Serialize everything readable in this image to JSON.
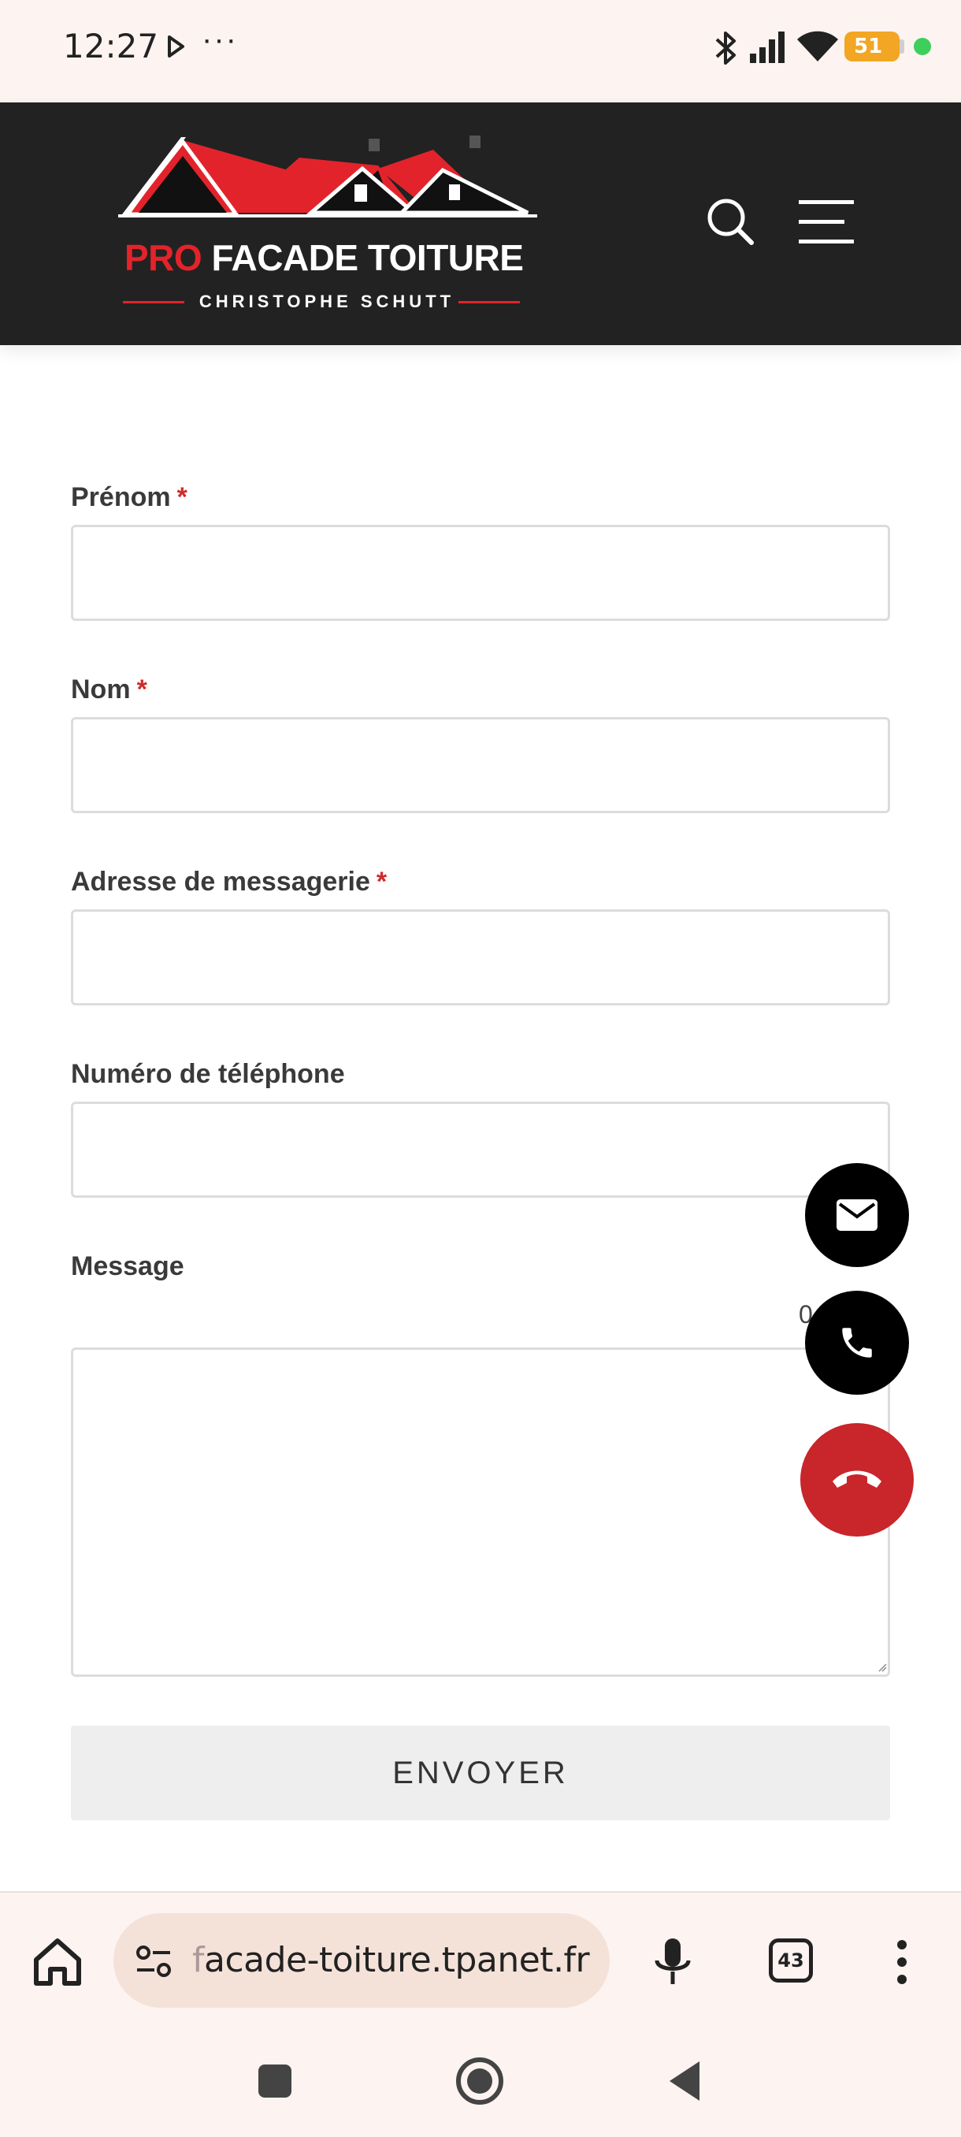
{
  "status_bar": {
    "time": "12:27",
    "more": "···",
    "battery": "51"
  },
  "header": {
    "logo": {
      "pro": "PRO",
      "name": "FACADE TOITURE",
      "subtitle": "CHRISTOPHE SCHUTT"
    }
  },
  "form": {
    "fields": [
      {
        "label": "Prénom",
        "required_mark": "*"
      },
      {
        "label": "Nom",
        "required_mark": "*"
      },
      {
        "label": "Adresse de messagerie",
        "required_mark": "*"
      },
      {
        "label": "Numéro de téléphone"
      }
    ],
    "message_label": "Message",
    "char_count": "0",
    "submit_label": "ENVOYER"
  },
  "browser": {
    "url_faded": "f",
    "url": "acade-toiture.tpanet.fr",
    "tab_count": "43"
  },
  "colors": {
    "header_bg": "#222222",
    "brand_red": "#e3232b",
    "hangup_red": "#c8262a",
    "required_red": "#d12a2a"
  }
}
